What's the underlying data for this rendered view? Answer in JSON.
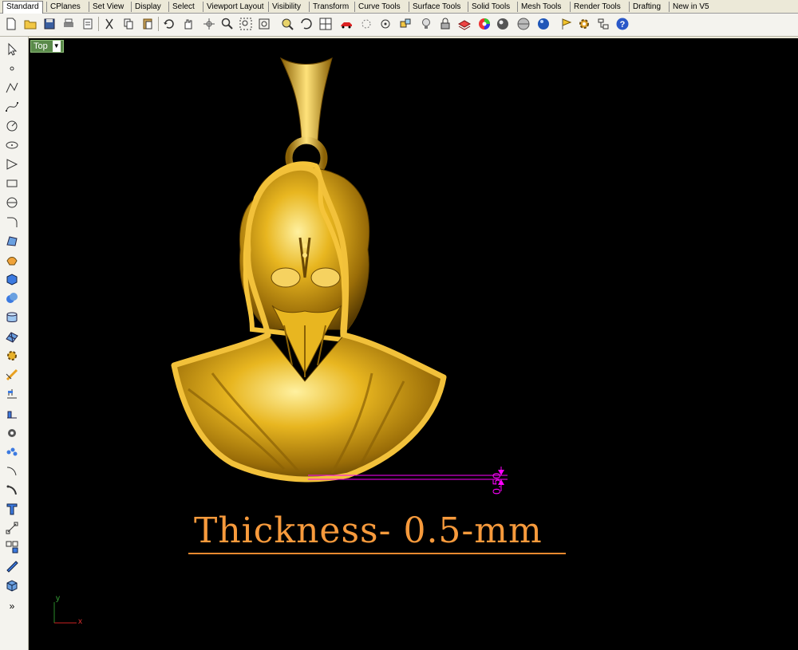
{
  "tabs": [
    "Standard",
    "CPlanes",
    "Set View",
    "Display",
    "Select",
    "Viewport Layout",
    "Visibility",
    "Transform",
    "Curve Tools",
    "Surface Tools",
    "Solid Tools",
    "Mesh Tools",
    "Render Tools",
    "Drafting",
    "New in V5"
  ],
  "viewport": {
    "label": "Top",
    "dimension_value": "0.50",
    "caption": "Thickness- 0.5-mm"
  },
  "axes": {
    "x": "x",
    "y": "y"
  },
  "more_tools": "»",
  "colors": {
    "viewport_bg": "#000000",
    "gold": "#d9a51c",
    "caption": "#f79a3c",
    "dimension": "#ff00ff"
  }
}
